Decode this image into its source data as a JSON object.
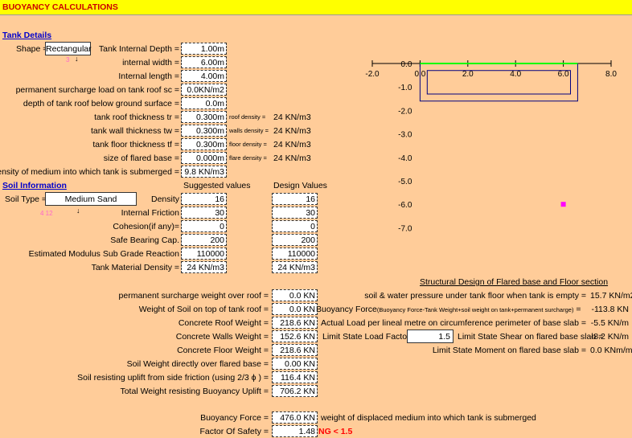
{
  "title": "BUOYANCY CALCULATIONS",
  "tank": {
    "section": "Tank Details",
    "shape_label": "Shape =",
    "shape_value": "Rectangular",
    "shape_marker": "3",
    "rows": [
      {
        "label": "Tank Internal Depth =",
        "value": "1.00m"
      },
      {
        "label": "internal width =",
        "value": "6.00m"
      },
      {
        "label": "Internal length =",
        "value": "4.00m"
      },
      {
        "label": "permanent surcharge load on tank roof sc =",
        "value": "0.0KN/m2"
      },
      {
        "label": "depth of tank roof below ground surface =",
        "value": "0.0m"
      },
      {
        "label": "tank roof thickness tr =",
        "value": "0.300m",
        "note_label": "roof density =",
        "note_value": "24 KN/m3"
      },
      {
        "label": "tank wall thickness tw =",
        "value": "0.300m",
        "note_label": "walls density =",
        "note_value": "24 KN/m3"
      },
      {
        "label": "tank floor thickness tf =",
        "value": "0.300m",
        "note_label": "floor density =",
        "note_value": "24 KN/m3"
      },
      {
        "label": "size of flared base =",
        "value": "0.000m",
        "note_label": "flare density =",
        "note_value": "24 KN/m3"
      },
      {
        "label": "Density of medium into which tank is submerged =",
        "value": "9.8 KN/m3"
      }
    ]
  },
  "soil": {
    "section": "Soil Information",
    "type_label": "Soil Type =",
    "type_value": "Medium Sand",
    "type_marker": "4 12",
    "col_suggested": "Suggested values",
    "col_design": "Design Values",
    "rows": [
      {
        "label": "Density",
        "suggested": "16",
        "design": "16"
      },
      {
        "label": "Internal Friction",
        "suggested": "30",
        "design": "30"
      },
      {
        "label": "Cohesion(if any)=",
        "suggested": "0",
        "design": "0"
      },
      {
        "label": "Safe Bearing Cap.",
        "suggested": "200",
        "design": "200"
      },
      {
        "label": "Estimated Modulus Sub Grade Reaction",
        "suggested": "110000",
        "design": "110000"
      },
      {
        "label": "Tank Material Density =",
        "suggested": "24 KN/m3",
        "design": "24 KN/m3"
      }
    ]
  },
  "weights": [
    {
      "label": "permanent surcharge weight over roof =",
      "value": "0.0 KN"
    },
    {
      "label": "Weight of Soil on top of tank roof =",
      "value": "0.0 KN"
    },
    {
      "label": "Concrete Roof Weight =",
      "value": "218.6 KN"
    },
    {
      "label": "Concrete Walls Weight =",
      "value": "152.6 KN"
    },
    {
      "label": "Concrete Floor Weight =",
      "value": "218.6 KN"
    },
    {
      "label": "Soil Weight directly over flared base =",
      "value": "0.00 KN"
    },
    {
      "label": "Soil resisting uplift from side friction (using 2/3 ϕ ) =",
      "value": "116.4 KN"
    },
    {
      "label": "Total Weight resisting Buoyancy Uplift =",
      "value": "706.2 KN"
    }
  ],
  "buoyancy": {
    "force_label": "Buoyancy Force =",
    "force_value": "476.0 KN",
    "force_note": "weight of displaced medium into which tank is submerged",
    "fos_label": "Factor Of Safety =",
    "fos_value": "1.48",
    "fos_status": "NG < 1.5"
  },
  "structural": {
    "heading": "Structural Design of Flared base and Floor section",
    "pressure_label": "soil & water pressure under tank floor when tank is empty =",
    "pressure_value": "15.7 KN/m2",
    "force_label_big": "Buoyancy Force",
    "force_label_small": "(Buoyancy Force-Tank Weight+soil weight on tank+permanent surcharge)",
    "force_eq": "=",
    "force_value": "-113.8 KN",
    "actual_load_label": "Actual Load per lineal metre on circumference perimeter of base slab =",
    "actual_load_value": "-5.5 KN/m",
    "lsf_label": "Limit State Load Factor =",
    "lsf_value": "1.5",
    "shear_label": "Limit State Shear on flared base slab =",
    "shear_value": "-8.2 KN/m",
    "moment_label": "Limit State Moment on flared base slab =",
    "moment_value": "0.0 KNm/m"
  },
  "chart_data": {
    "type": "scatter",
    "x_ticks": [
      "-2.0",
      "0.0",
      "2.0",
      "4.0",
      "6.0",
      "8.0"
    ],
    "y_ticks": [
      "0.0",
      "-1.0",
      "-2.0",
      "-3.0",
      "-4.0",
      "-5.0",
      "-6.0",
      "-7.0"
    ],
    "xlim": [
      -2.0,
      8.0
    ],
    "ylim": [
      -7.0,
      0.0
    ],
    "tank_outline": [
      [
        0.0,
        0.0
      ],
      [
        6.6,
        0.0
      ],
      [
        6.6,
        -1.6
      ],
      [
        0.0,
        -1.6
      ]
    ],
    "tank_inner": [
      [
        0.3,
        -0.3
      ],
      [
        6.3,
        -0.3
      ],
      [
        6.3,
        -1.3
      ],
      [
        0.3,
        -1.3
      ]
    ],
    "ground_line": [
      [
        0.0,
        0.0
      ],
      [
        6.6,
        0.0
      ]
    ],
    "water_level_point": [
      6.0,
      -6.0
    ],
    "colors": {
      "ground": "#00ff00",
      "tank": "#000080",
      "marker": "#ff00ff"
    }
  }
}
